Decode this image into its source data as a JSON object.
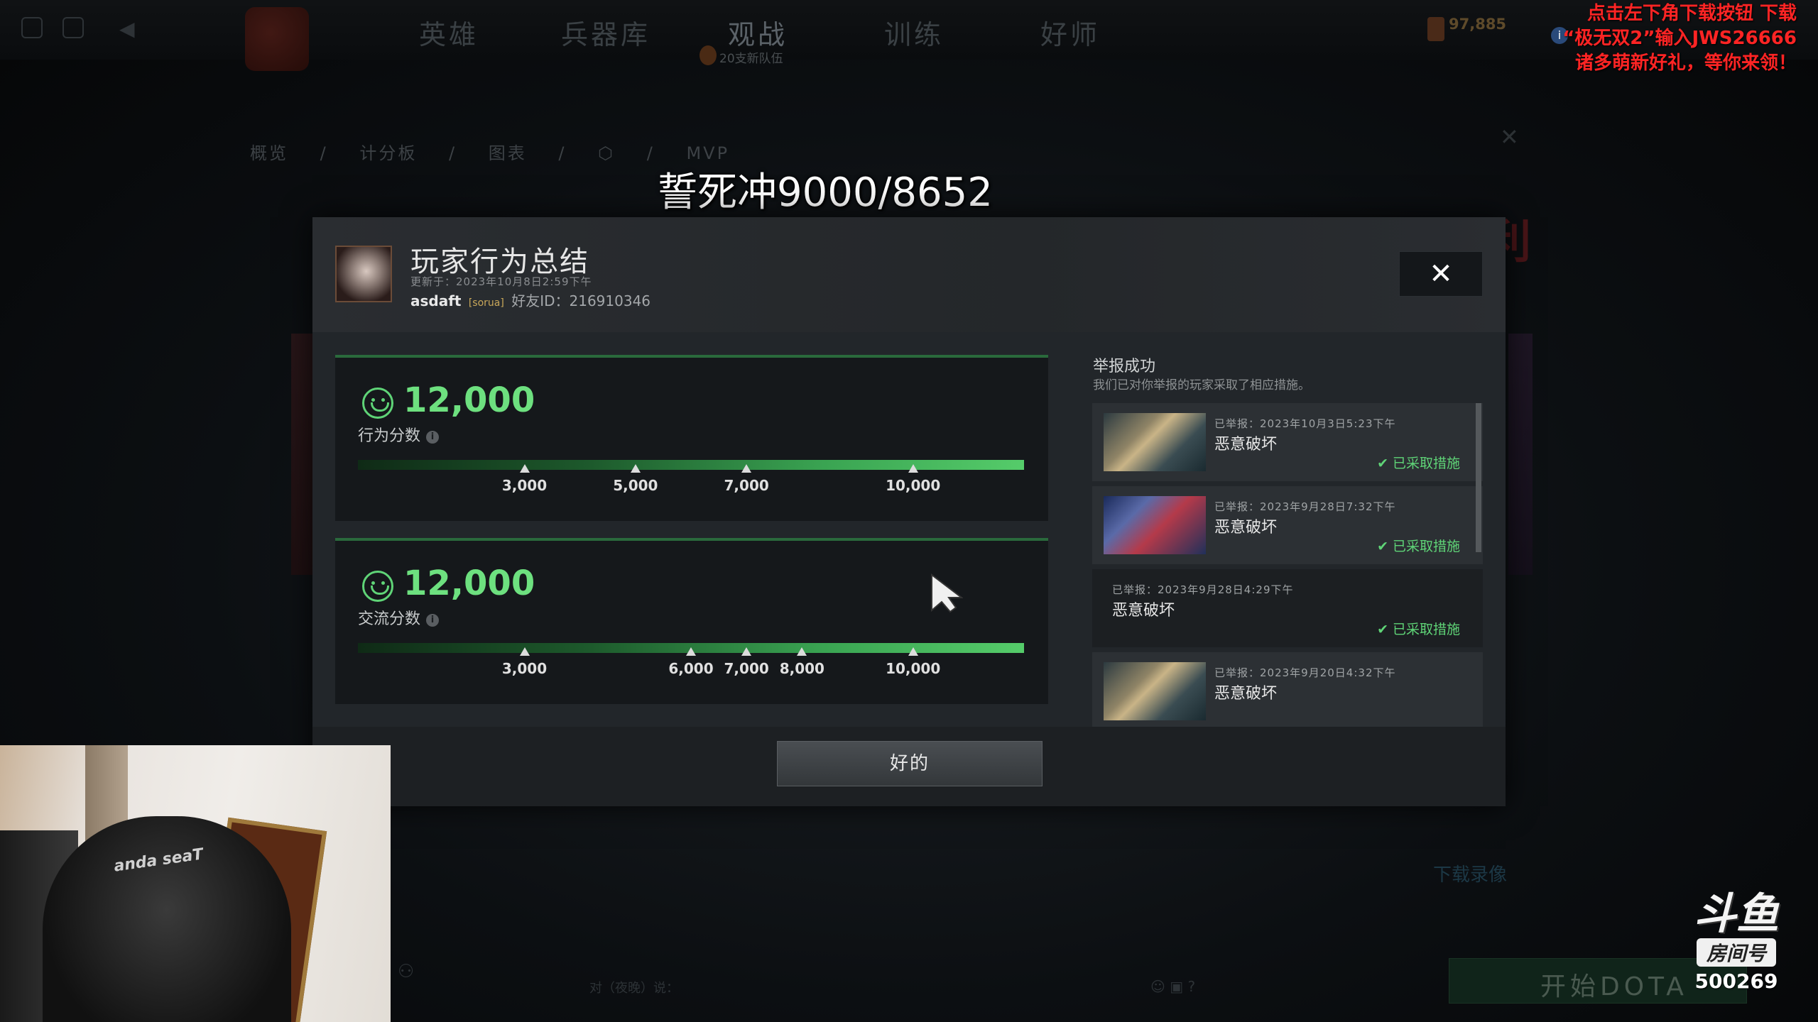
{
  "stream_title": "誓死冲9000/8652",
  "promo": {
    "line1": "点击左下角下载按钮 下载",
    "line2": "“极无双2”输入JWS26666",
    "line3": "诸多萌新好礼，等你来领！"
  },
  "background": {
    "nav": [
      "英雄",
      "兵器库",
      "观战",
      "训练",
      "好师"
    ],
    "nav_sub": "20支新队伍",
    "shards": "97,885",
    "breadcrumb": [
      "概览",
      "/",
      "计分板",
      "/",
      "图表",
      "/",
      "",
      "/",
      "MVP"
    ],
    "victory": "大夜胜利",
    "row1": "",
    "row2": "",
    "download": "下载录像",
    "chat_label": "对（夜晚）说：",
    "play_button": "开始DOTA"
  },
  "modal": {
    "title": "玩家行为总结",
    "updated": "更新于：2023年10月8日2:59下午",
    "player_name": "asdaft",
    "player_tag": "[sorua]",
    "friend_id": "好友ID：216910346",
    "close_glyph": "✕",
    "ok_label": "好的"
  },
  "behavior_score": {
    "value": "12,000",
    "label": "行为分数",
    "bar_min": 0,
    "bar_max": 12000,
    "ticks": [
      {
        "value": 3000,
        "label": "3,000"
      },
      {
        "value": 5000,
        "label": "5,000"
      },
      {
        "value": 7000,
        "label": "7,000"
      },
      {
        "value": 10000,
        "label": "10,000"
      }
    ]
  },
  "communication_score": {
    "value": "12,000",
    "label": "交流分数",
    "bar_min": 0,
    "bar_max": 12000,
    "ticks": [
      {
        "value": 3000,
        "label": "3,000"
      },
      {
        "value": 6000,
        "label": "6,000"
      },
      {
        "value": 7000,
        "label": "7,000"
      },
      {
        "value": 8000,
        "label": "8,000"
      },
      {
        "value": 10000,
        "label": "10,000"
      }
    ]
  },
  "reports": {
    "heading": "举报成功",
    "subheading": "我们已对你举报的玩家采取了相应措施。",
    "items": [
      {
        "date": "已举报：2023年10月3日5:23下午",
        "reason": "恶意破坏",
        "status": "已采取措施"
      },
      {
        "date": "已举报：2023年9月28日7:32下午",
        "reason": "恶意破坏",
        "status": "已采取措施"
      },
      {
        "date": "已举报：2023年9月28日4:29下午",
        "reason": "恶意破坏",
        "status": "已采取措施"
      },
      {
        "date": "已举报：2023年9月20日4:32下午",
        "reason": "恶意破坏",
        "status": ""
      }
    ]
  },
  "douyu": {
    "logo": "斗鱼",
    "label": "房间号",
    "room": "500269"
  },
  "webcam": {
    "chair_text": "anda seaT"
  },
  "colors": {
    "accent_green": "#6de07f",
    "promo_red": "#ff2424",
    "modal_bg": "#22262a"
  }
}
